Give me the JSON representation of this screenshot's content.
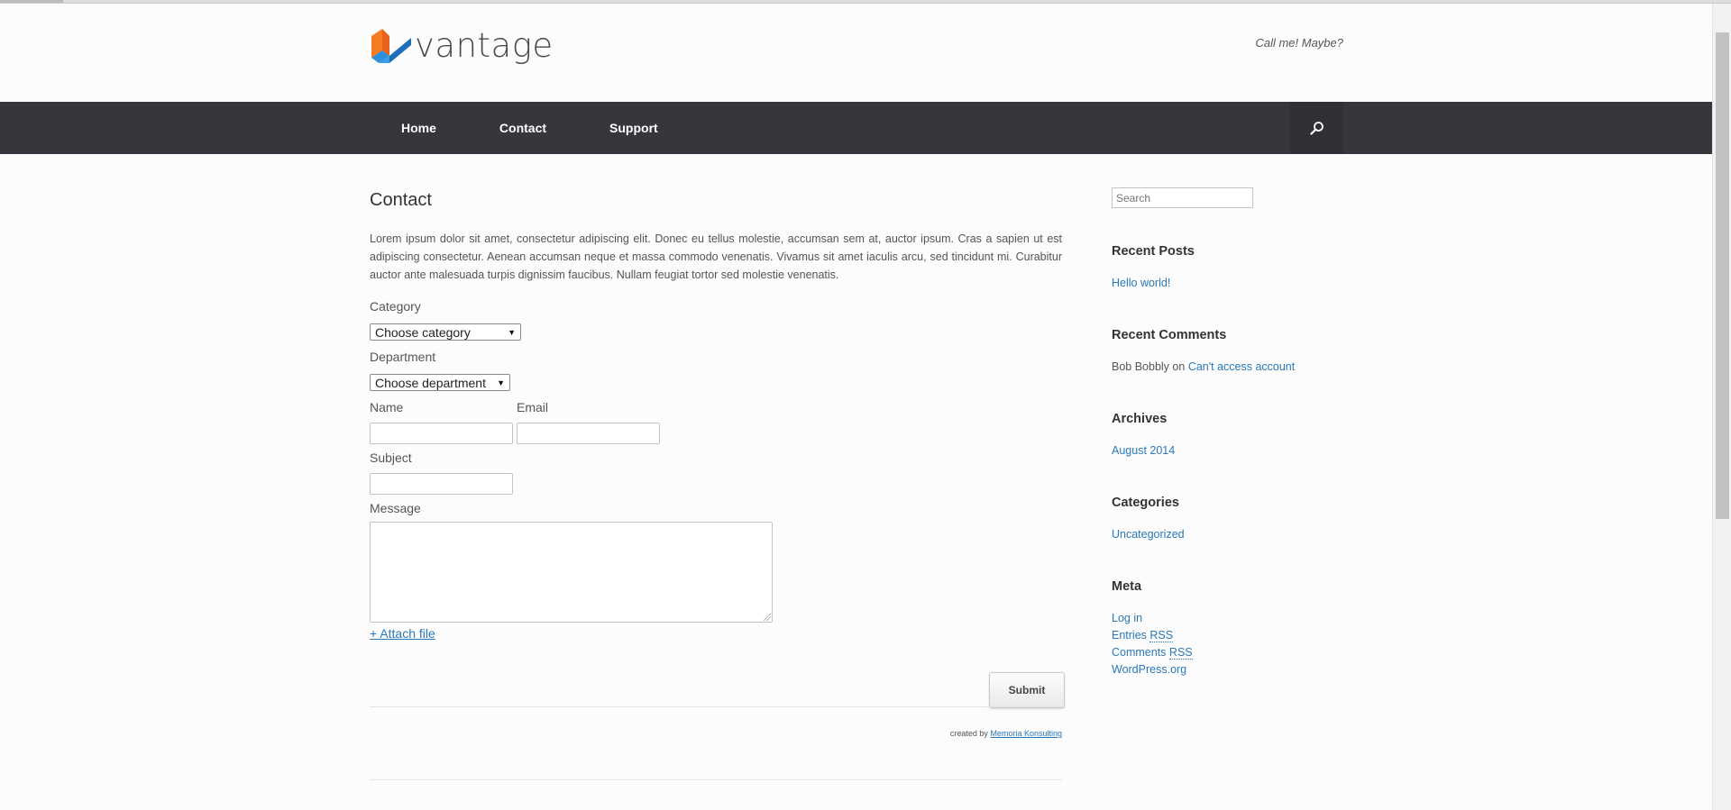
{
  "header": {
    "logo_text": "vantage",
    "tagline": "Call me! Maybe?"
  },
  "nav": {
    "items": [
      "Home",
      "Contact",
      "Support"
    ]
  },
  "page": {
    "title": "Contact",
    "intro": "Lorem ipsum dolor sit amet, consectetur adipiscing elit. Donec eu tellus molestie, accumsan sem at, auctor ipsum. Cras a sapien ut est adipiscing consectetur. Aenean accumsan neque et massa commodo venenatis. Vivamus sit amet iaculis arcu, sed tincidunt mi. Curabitur auctor ante malesuada turpis dignissim faucibus. Nullam feugiat tortor sed molestie venenatis."
  },
  "form": {
    "category_label": "Category",
    "category_value": "Choose category",
    "department_label": "Department",
    "department_value": "Choose department",
    "name_label": "Name",
    "email_label": "Email",
    "subject_label": "Subject",
    "message_label": "Message",
    "attach_label": "+ Attach file",
    "submit_label": "Submit"
  },
  "footer": {
    "credit_prefix": "created by",
    "credit_link": "Memoria Konsulting"
  },
  "sidebar": {
    "search_placeholder": "Search",
    "recent_posts_title": "Recent Posts",
    "recent_posts": [
      "Hello world!"
    ],
    "recent_comments_title": "Recent Comments",
    "comment_author": "Bob Bobbly",
    "comment_on": "on",
    "comment_post": "Can't access account",
    "archives_title": "Archives",
    "archives": [
      "August 2014"
    ],
    "categories_title": "Categories",
    "categories": [
      "Uncategorized"
    ],
    "meta_title": "Meta",
    "meta_login": "Log in",
    "meta_entries": "Entries",
    "meta_comments": "Comments",
    "meta_rss": "RSS",
    "meta_wordpress": "WordPress.org"
  },
  "colors": {
    "nav_bg": "#35373c",
    "link": "#2a78b8",
    "logo_orange": "#f47b20",
    "logo_blue": "#2f8fd8"
  }
}
